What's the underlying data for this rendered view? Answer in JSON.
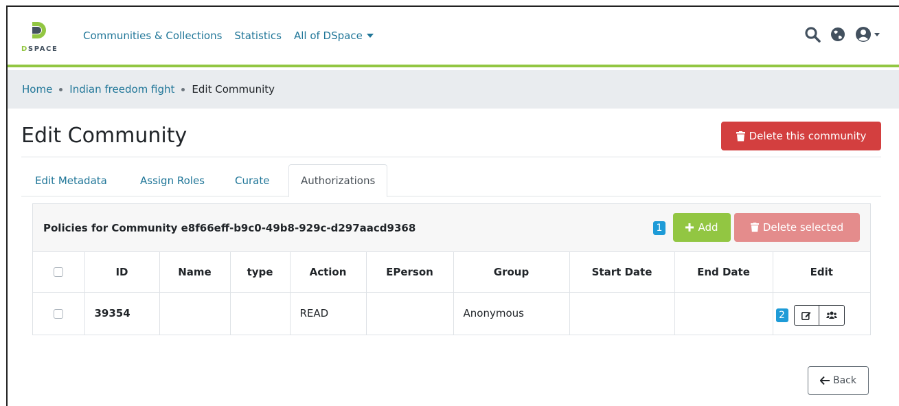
{
  "header": {
    "logo_text_accent": "D",
    "logo_text_rest": "SPACE",
    "nav_links": [
      "Communities & Collections",
      "Statistics",
      "All of DSpace"
    ],
    "icons": [
      "search-icon",
      "globe-icon",
      "user-circle-icon"
    ],
    "accent_color": "#92c642",
    "link_color": "#207698"
  },
  "breadcrumb": {
    "items": [
      "Home",
      "Indian freedom fight"
    ],
    "active": "Edit Community"
  },
  "page": {
    "title": "Edit Community",
    "delete_button": "Delete this community",
    "delete_color": "#d33f3f"
  },
  "tabs": [
    "Edit Metadata",
    "Assign Roles",
    "Curate",
    "Authorizations"
  ],
  "active_tab": "Authorizations",
  "policies": {
    "title": "Policies for Community e8f66eff-b9c0-49b8-929c-d297aacd9368",
    "badge_1": "1",
    "add_label": "Add",
    "delete_selected_label": "Delete selected",
    "columns": [
      "ID",
      "Name",
      "type",
      "Action",
      "EPerson",
      "Group",
      "Start Date",
      "End Date",
      "Edit"
    ],
    "rows": [
      {
        "id": "39354",
        "name": "",
        "type": "",
        "action": "READ",
        "eperson": "",
        "group": "Anonymous",
        "start_date": "",
        "end_date": "",
        "badge": "2"
      }
    ]
  },
  "back_label": "Back"
}
